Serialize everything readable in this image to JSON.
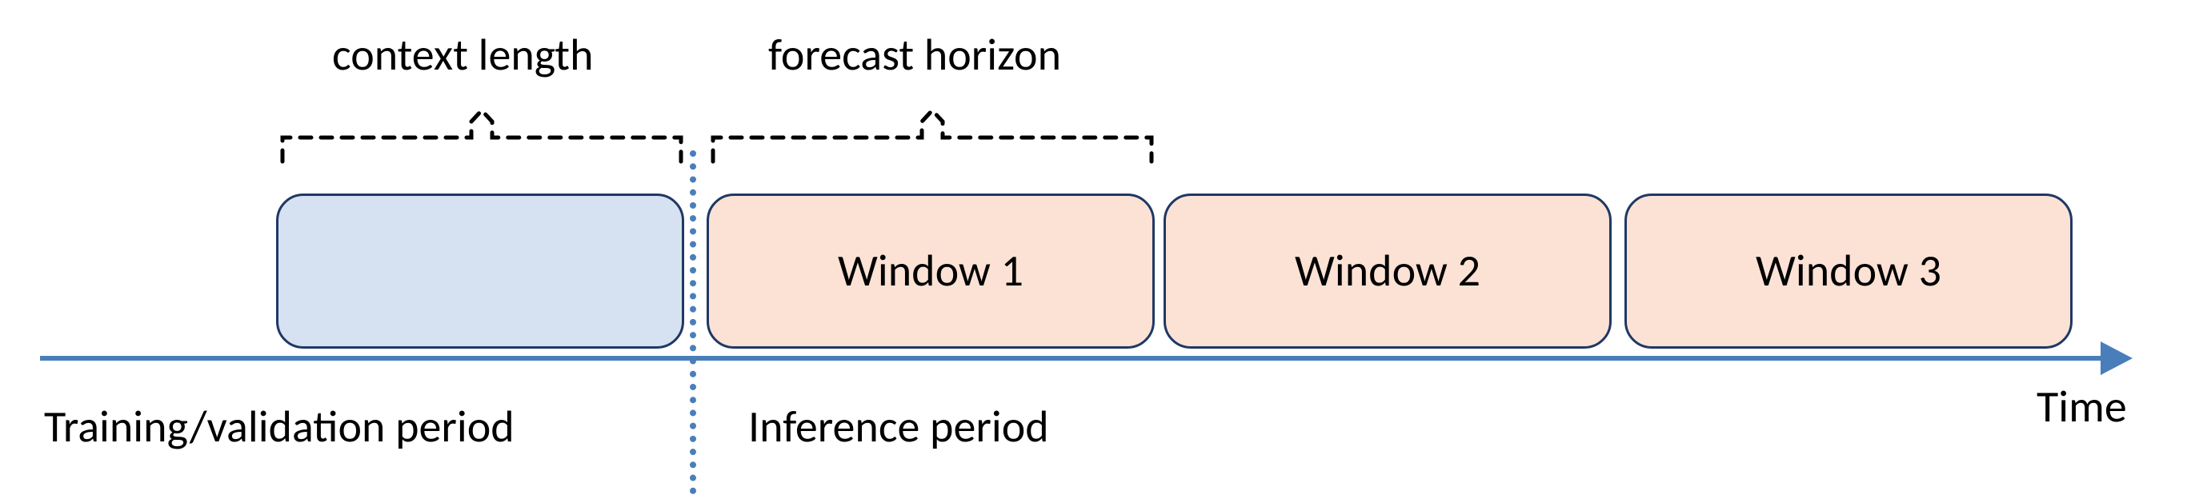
{
  "labels": {
    "context_length": "context length",
    "forecast_horizon": "forecast horizon",
    "training_period": "Training/validation period",
    "inference_period": "Inference period",
    "time_axis": "Time"
  },
  "windows": {
    "w1": "Window 1",
    "w2": "Window 2",
    "w3": "Window 3"
  },
  "colors": {
    "axis": "#4a7ebb",
    "context_fill": "#d6e1f1",
    "window_fill": "#fbe2d5",
    "box_border": "#1f3864"
  },
  "diagram": {
    "type": "timeline",
    "description": "A time axis split into a training/validation period and an inference period. The last context-length segment of the training period (blue box) feeds predictions over successive forecast-horizon windows in the inference period (three orange boxes: Window 1, Window 2, Window 3)."
  }
}
